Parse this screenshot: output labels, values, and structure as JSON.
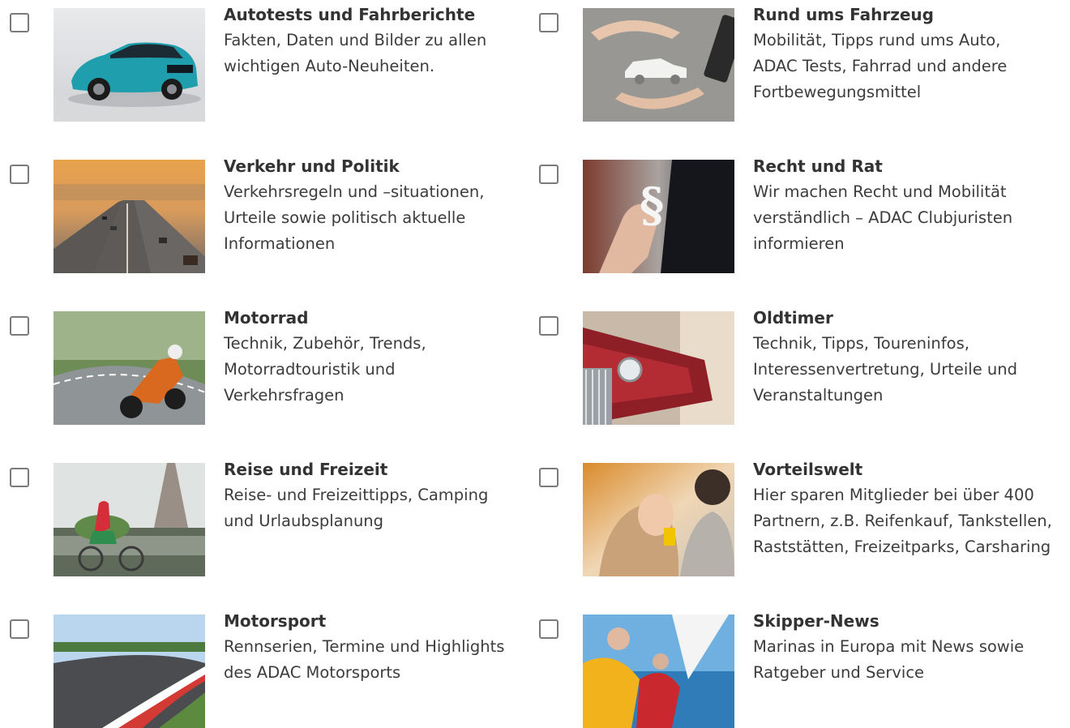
{
  "topics": [
    {
      "id": "autotests",
      "title": "Autotests und Fahrberichte",
      "lines": [
        "Fakten, Daten und Bilder zu allen",
        "wichtigen Auto-Neuheiten."
      ],
      "image": "blue-electric-car-photo",
      "checked": false
    },
    {
      "id": "rund-ums-fahrzeug",
      "title": "Rund ums Fahrzeug",
      "lines": [
        "Mobilität, Tipps rund ums Auto,",
        "ADAC Tests, Fahrrad und andere",
        "Fortbewegungsmittel"
      ],
      "image": "hands-around-paper-car-photo",
      "checked": false
    },
    {
      "id": "verkehr-politik",
      "title": "Verkehr und Politik",
      "lines": [
        "Verkehrsregeln und –situationen,",
        "Urteile sowie politisch aktuelle",
        "Informationen"
      ],
      "image": "highway-at-sunset-photo",
      "checked": false
    },
    {
      "id": "recht-rat",
      "title": "Recht und Rat",
      "lines": [
        "Wir machen Recht und Mobilität",
        "verständlich – ADAC Clubjuristen",
        "informieren"
      ],
      "image": "hand-with-paragraph-sign-photo",
      "checked": false
    },
    {
      "id": "motorrad",
      "title": "Motorrad",
      "lines": [
        "Technik, Zubehör, Trends,",
        "Motorradtouristik und",
        "Verkehrsfragen"
      ],
      "image": "motorcyclist-on-curve-photo",
      "checked": false
    },
    {
      "id": "oldtimer",
      "title": "Oldtimer",
      "lines": [
        "Technik, Tipps, Toureninfos,",
        "Interessenvertretung, Urteile und",
        "Veranstaltungen"
      ],
      "image": "classic-red-car-row-photo",
      "checked": false
    },
    {
      "id": "reise-freizeit",
      "title": "Reise und Freizeit",
      "lines": [
        "Reise- und Freizeittipps, Camping",
        "und Urlaubsplanung"
      ],
      "image": "cyclist-eiffel-tower-photo",
      "checked": false
    },
    {
      "id": "vorteilswelt",
      "title": "Vorteilswelt",
      "lines": [
        "Hier sparen Mitglieder bei über 400",
        "Partnern, z.B. Reifenkauf, Tankstellen,",
        "Raststätten, Freizeitparks, Carsharing"
      ],
      "image": "smiling-couple-photo",
      "checked": false
    },
    {
      "id": "motorsport",
      "title": "Motorsport",
      "lines": [
        "Rennserien, Termine und Highlights",
        "des ADAC Motorsports"
      ],
      "image": "race-track-curve-photo",
      "checked": false
    },
    {
      "id": "skipper-news",
      "title": "Skipper-News",
      "lines": [
        "Marinas in Europa mit News sowie",
        "Ratgeber und Service"
      ],
      "image": "sailors-on-boat-photo",
      "checked": false
    }
  ]
}
